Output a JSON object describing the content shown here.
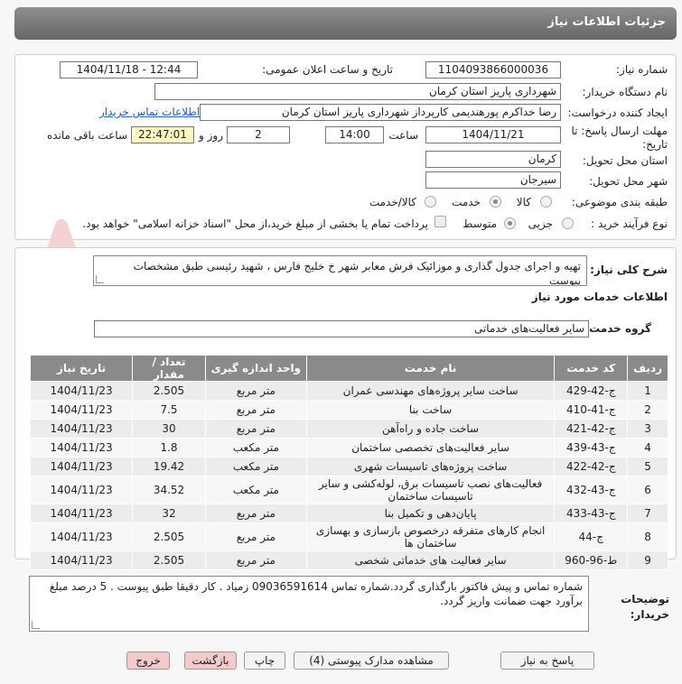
{
  "header": {
    "title": "جزئیات اطلاعات نیاز"
  },
  "form": {
    "need_number_label": "شماره نیاز:",
    "need_number": "1104093866000036",
    "announce_label": "تاریخ و ساعت اعلان عمومی:",
    "announce_value": "1404/11/18 - 12:44",
    "buyer_org_label": "نام دستگاه خریدار:",
    "buyer_org": "شهرداری پاریز استان کرمان",
    "requester_label": "ایجاد کننده درخواست:",
    "requester": "رضا خداکرم پورهندیمی کارپرداز شهرداری پاریز استان کرمان",
    "contact_link": "اطلاعات تماس خریدار",
    "deadline_label": "مهلت ارسال پاسخ: تا تاریخ:",
    "deadline_date": "1404/11/21",
    "time_label": "ساعت",
    "deadline_time": "14:00",
    "days_value": "2",
    "days_label": "روز و",
    "remaining_time": "22:47:01",
    "remaining_label": "ساعت باقی مانده",
    "province_label": "استان محل تحویل:",
    "province": "کرمان",
    "city_label": "شهر محل تحویل:",
    "city": "سیرجان",
    "category_label": "طبقه بندی موضوعی:",
    "category_options": [
      "کالا",
      "خدمت",
      "کالا/خدمت"
    ],
    "category_selected": "خدمت",
    "process_label": "نوع فرآیند خرید :",
    "process_options": [
      "جزیی",
      "متوسط"
    ],
    "process_selected": "متوسط",
    "payment_note": "پرداخت تمام یا بخشی از مبلغ خرید،از محل \"اسناد خزانه اسلامی\" خواهد بود."
  },
  "description": {
    "label": "شرح کلی نیاز:",
    "text": "تهیه و اجرای جدول گذاری و موزائیک فرش معابر شهر خ خلیج فارس ، شهید رئیسی طبق مشخصات پیوست"
  },
  "services": {
    "section_title": "اطلاعات خدمات مورد نیاز",
    "group_label": "گروه خدمت:",
    "group_value": "سایر فعالیت‌های خدماتی",
    "columns": [
      "ردیف",
      "کد خدمت",
      "نام خدمت",
      "واحد اندازه گیری",
      "تعداد / مقدار",
      "تاریخ نیاز"
    ],
    "rows": [
      {
        "row": "1",
        "code": "ج-42-429",
        "name": "ساخت سایر پروژه‌های مهندسی عمران",
        "unit": "متر مربع",
        "qty": "2.505",
        "date": "1404/11/23"
      },
      {
        "row": "2",
        "code": "ج-41-410",
        "name": "ساخت بنا",
        "unit": "متر مربع",
        "qty": "7.5",
        "date": "1404/11/23"
      },
      {
        "row": "3",
        "code": "ج-42-421",
        "name": "ساخت جاده و راه‌آهن",
        "unit": "متر مربع",
        "qty": "30",
        "date": "1404/11/23"
      },
      {
        "row": "4",
        "code": "ج-43-439",
        "name": "سایر فعالیت‌های تخصصی ساختمان",
        "unit": "متر مکعب",
        "qty": "1.8",
        "date": "1404/11/23"
      },
      {
        "row": "5",
        "code": "ج-42-422",
        "name": "ساخت پروژه‌های تاسیسات شهری",
        "unit": "متر مکعب",
        "qty": "19.42",
        "date": "1404/11/23"
      },
      {
        "row": "6",
        "code": "ج-43-432",
        "name": "فعالیت‌های نصب تاسیسات برق، لوله‌کشی و سایر تاسیسات ساختمان",
        "unit": "متر مکعب",
        "qty": "34.52",
        "date": "1404/11/23"
      },
      {
        "row": "7",
        "code": "ج-43-433",
        "name": "پایان‌دهی و تکمیل بنا",
        "unit": "متر مربع",
        "qty": "32",
        "date": "1404/11/23"
      },
      {
        "row": "8",
        "code": "ج-44",
        "name": "انجام کارهای متفرقه درخصوص بازسازی و بهسازی ساختمان ها",
        "unit": "متر مربع",
        "qty": "2.505",
        "date": "1404/11/23"
      },
      {
        "row": "9",
        "code": "ط-96-960",
        "name": "سایر فعالیت های خدماتی شخصی",
        "unit": "متر مربع",
        "qty": "2.505",
        "date": "1404/11/23"
      }
    ]
  },
  "buyer_notes": {
    "label": "توضیحات خریدار:",
    "text": "شماره تماس و پیش فاکتور بارگذاری گردد.شماره تماس 09036591614 زمیاد . کار دقیقا طبق پیوست . 5 درصد مبلغ برآورد جهت ضمانت واریز گردد."
  },
  "buttons": {
    "reply": "پاسخ به نیاز",
    "attachments": "مشاهده مدارک پیوستی (4)",
    "print": "چاپ",
    "back": "بازگشت",
    "exit": "خروج"
  },
  "watermark": {
    "text": "AriaTender.net"
  }
}
